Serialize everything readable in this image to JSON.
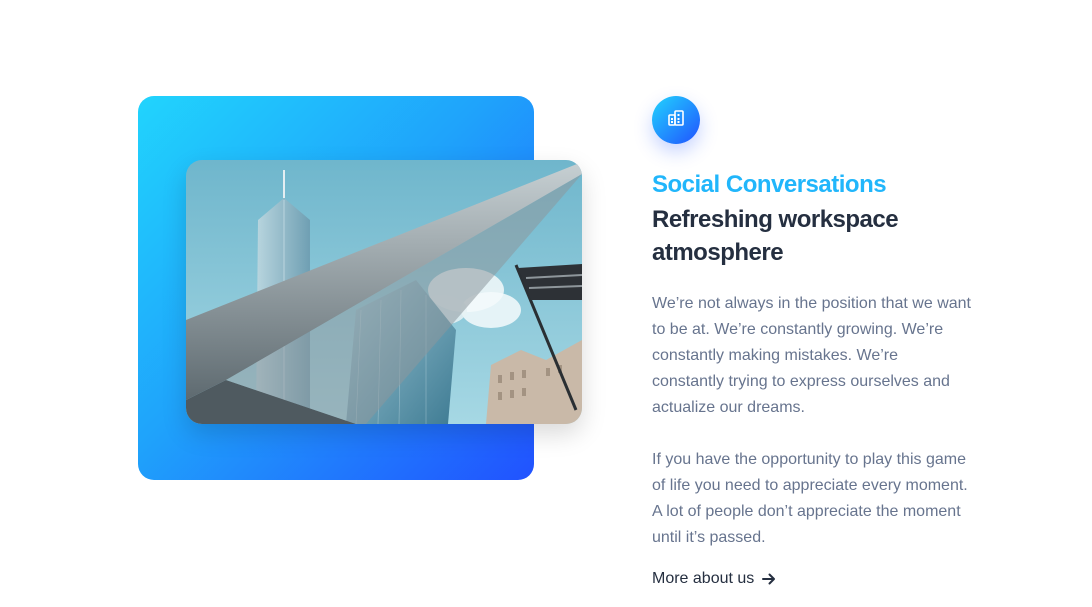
{
  "feature": {
    "icon": "building-icon",
    "eyebrow": "Social Conversations",
    "heading": "Refreshing workspace atmosphere",
    "paragraphs": [
      "We’re not always in the position that we want to be at. We’re constantly growing. We’re constantly making mistakes. We’re constantly trying to express ourselves and actualize our dreams.",
      "If you have the opportunity to play this game of life you need to appreciate every moment. A lot of people don’t appreciate the moment until it’s passed."
    ],
    "link_label": "More about us",
    "link_icon": "arrow-right-icon"
  },
  "media": {
    "image_icon": "city-architecture-photo"
  },
  "colors": {
    "accent": "#21b6fb",
    "gradient_start": "#21d4fd",
    "gradient_end": "#2152ff",
    "heading": "#252f40",
    "body_text": "#67748e"
  }
}
